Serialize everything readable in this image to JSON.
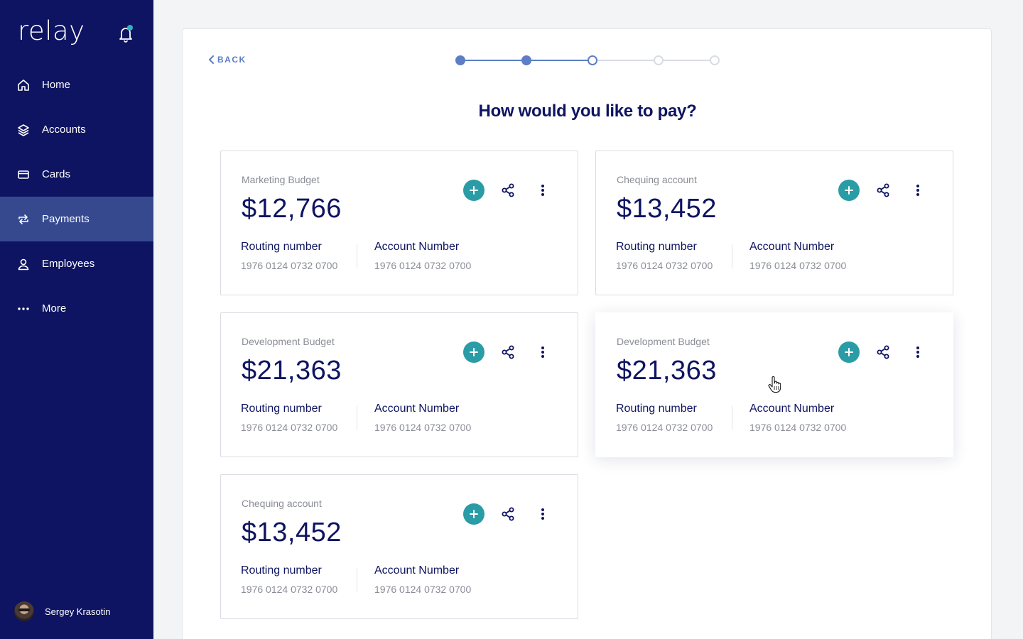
{
  "app": {
    "logo": "relay"
  },
  "sidebar": {
    "items": [
      {
        "label": "Home",
        "icon": "home-icon",
        "active": false
      },
      {
        "label": "Accounts",
        "icon": "layers-icon",
        "active": false
      },
      {
        "label": "Cards",
        "icon": "card-icon",
        "active": false
      },
      {
        "label": "Payments",
        "icon": "transfer-icon",
        "active": true
      },
      {
        "label": "Employees",
        "icon": "user-icon",
        "active": false
      },
      {
        "label": "More",
        "icon": "more-horizontal-icon",
        "active": false
      }
    ],
    "user": {
      "name": "Sergey Krasotin"
    }
  },
  "main": {
    "back_label": "BACK",
    "heading": "How would you like to pay?",
    "stepper": {
      "total_steps": 5,
      "completed_steps": 2,
      "current_step": 3
    },
    "cards": [
      {
        "name": "Marketing Budget",
        "amount": "$12,766",
        "routing_label": "Routing number",
        "routing_value": "1976 0124 0732 0700",
        "account_label": "Account Number",
        "account_value": "1976 0124 0732 0700"
      },
      {
        "name": "Chequing account",
        "amount": "$13,452",
        "routing_label": "Routing number",
        "routing_value": "1976 0124 0732 0700",
        "account_label": "Account Number",
        "account_value": "1976 0124 0732 0700"
      },
      {
        "name": "Development Budget",
        "amount": "$21,363",
        "routing_label": "Routing number",
        "routing_value": "1976 0124 0732 0700",
        "account_label": "Account Number",
        "account_value": "1976 0124 0732 0700"
      },
      {
        "name": "Development Budget",
        "amount": "$21,363",
        "routing_label": "Routing number",
        "routing_value": "1976 0124 0732 0700",
        "account_label": "Account Number",
        "account_value": "1976 0124 0732 0700",
        "hovered": true
      },
      {
        "name": "Chequing account",
        "amount": "$13,452",
        "routing_label": "Routing number",
        "routing_value": "1976 0124 0732 0700",
        "account_label": "Account Number",
        "account_value": "1976 0124 0732 0700"
      }
    ]
  },
  "colors": {
    "sidebar_bg": "#0e1461",
    "sidebar_active": "#36498f",
    "accent_teal": "#2a9ca6",
    "stepper_blue": "#5d7ec5",
    "heading_navy": "#0e1461"
  }
}
